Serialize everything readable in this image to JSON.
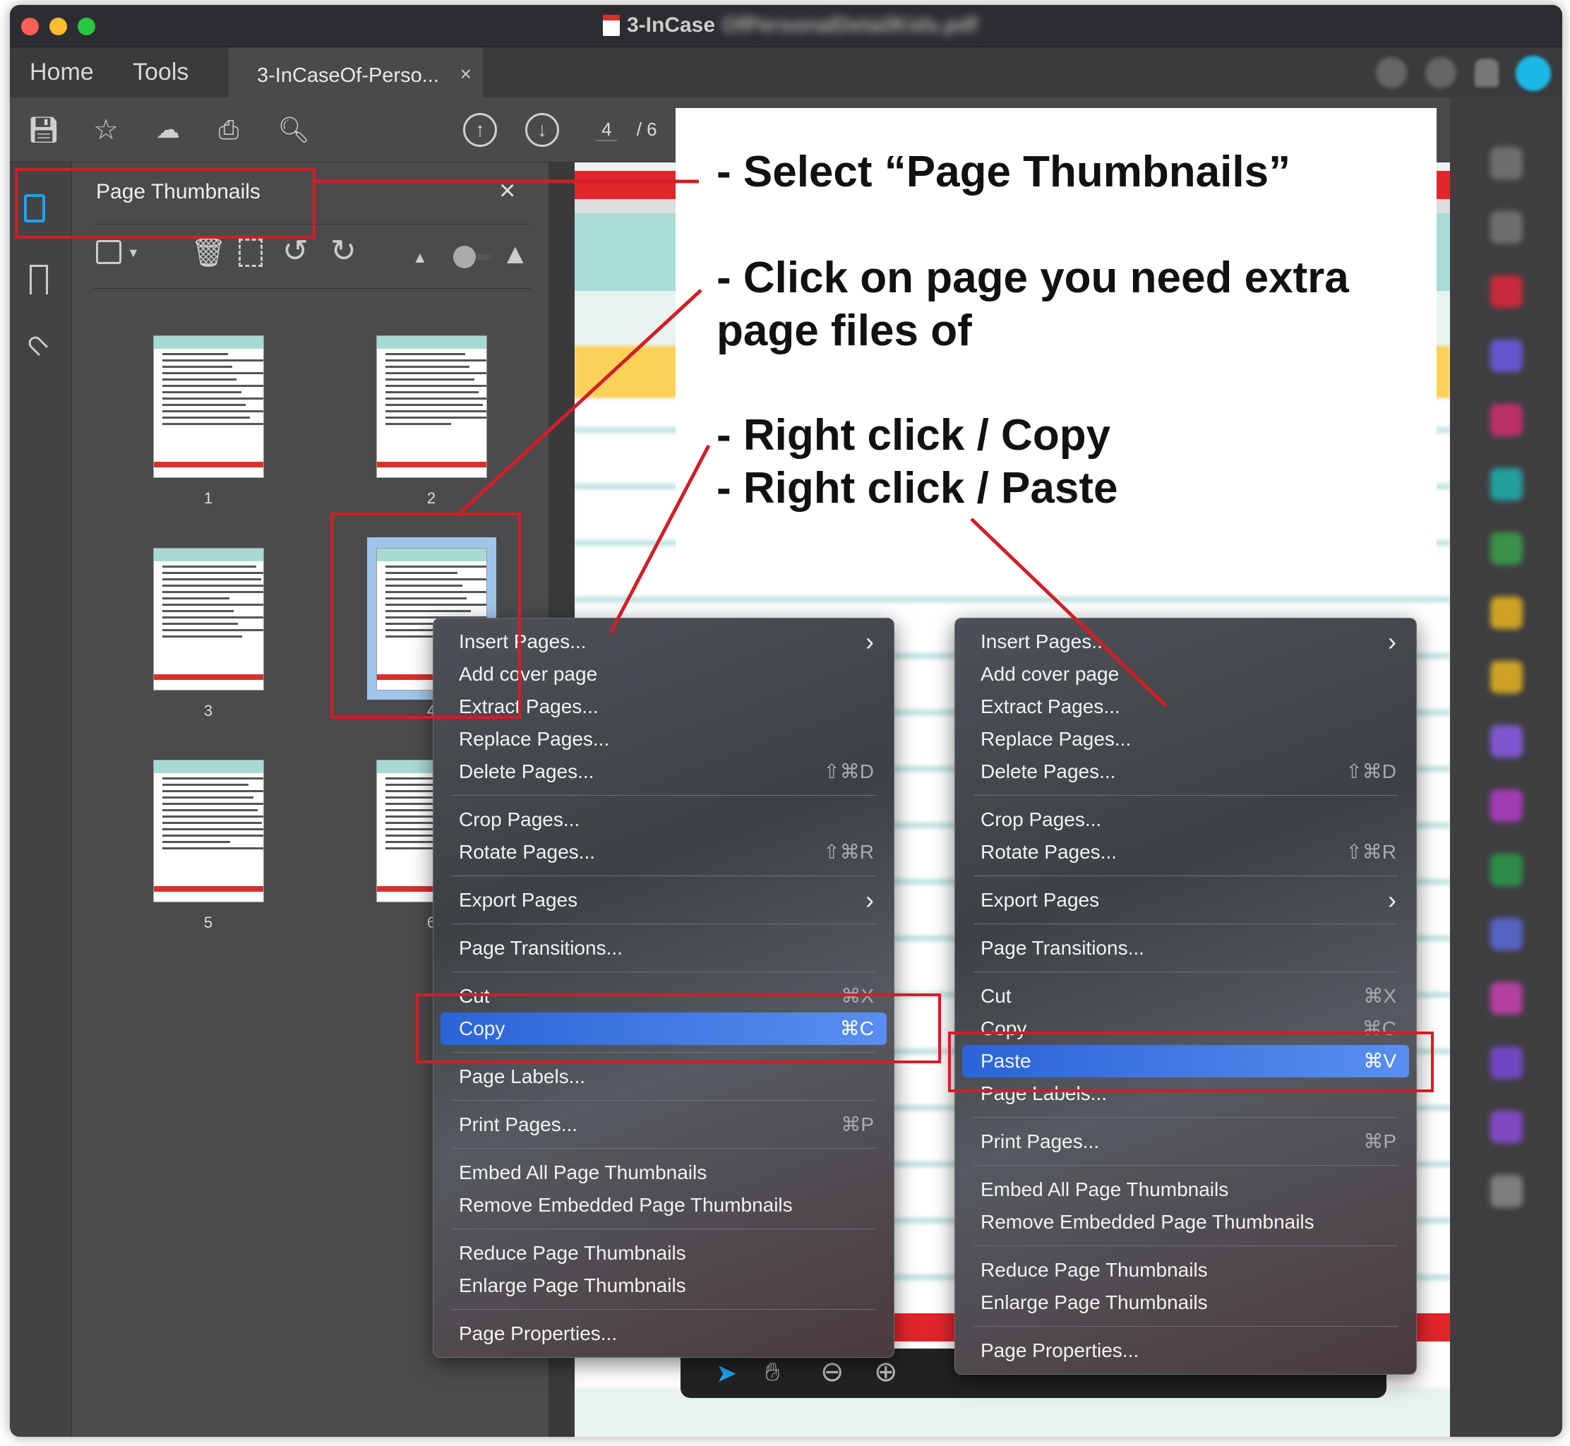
{
  "window": {
    "title": "3-InCaseOf-Personal-Detail-Kids.pdf",
    "title_visible": "3-InCase"
  },
  "tabs": {
    "home": "Home",
    "tools": "Tools",
    "document": "3-InCaseOf-Perso...",
    "close": "×"
  },
  "toolbar": {
    "current_page": "4",
    "total_pages": "/ 6"
  },
  "thumbnails_panel": {
    "title": "Page Thumbnails",
    "close": "×",
    "pages": [
      {
        "label": "1",
        "selected": false
      },
      {
        "label": "2",
        "selected": false
      },
      {
        "label": "3",
        "selected": false
      },
      {
        "label": "4",
        "selected": true
      },
      {
        "label": "5",
        "selected": false
      },
      {
        "label": "6",
        "selected": false
      }
    ]
  },
  "annotations": {
    "step1": "- Select “Page Thumbnails”",
    "step2_line1": "- Click on page you need extra",
    "step2_line2": "page files of",
    "step3": "- Right click / Copy",
    "step4": "- Right click / Paste"
  },
  "menu_copy": [
    {
      "label": "Insert Pages...",
      "submenu": true
    },
    {
      "label": "Add cover page"
    },
    {
      "label": "Extract Pages..."
    },
    {
      "label": "Replace Pages..."
    },
    {
      "label": "Delete Pages...",
      "shortcut": "⇧⌘D"
    },
    {
      "sep": true
    },
    {
      "label": "Crop Pages..."
    },
    {
      "label": "Rotate Pages...",
      "shortcut": "⇧⌘R"
    },
    {
      "sep": true
    },
    {
      "label": "Export Pages",
      "submenu": true
    },
    {
      "sep": true
    },
    {
      "label": "Page Transitions..."
    },
    {
      "sep": true
    },
    {
      "label": "Cut",
      "shortcut": "⌘X"
    },
    {
      "label": "Copy",
      "shortcut": "⌘C",
      "highlighted": true
    },
    {
      "sep": true
    },
    {
      "label": "Page Labels..."
    },
    {
      "sep": true
    },
    {
      "label": "Print Pages...",
      "shortcut": "⌘P"
    },
    {
      "sep": true
    },
    {
      "label": "Embed All Page Thumbnails"
    },
    {
      "label": "Remove Embedded Page Thumbnails"
    },
    {
      "sep": true
    },
    {
      "label": "Reduce Page Thumbnails"
    },
    {
      "label": "Enlarge Page Thumbnails"
    },
    {
      "sep": true
    },
    {
      "label": "Page Properties..."
    }
  ],
  "menu_paste": [
    {
      "label": "Insert Pages...",
      "submenu": true
    },
    {
      "label": "Add cover page"
    },
    {
      "label": "Extract Pages..."
    },
    {
      "label": "Replace Pages..."
    },
    {
      "label": "Delete Pages...",
      "shortcut": "⇧⌘D"
    },
    {
      "sep": true
    },
    {
      "label": "Crop Pages..."
    },
    {
      "label": "Rotate Pages...",
      "shortcut": "⇧⌘R"
    },
    {
      "sep": true
    },
    {
      "label": "Export Pages",
      "submenu": true
    },
    {
      "sep": true
    },
    {
      "label": "Page Transitions..."
    },
    {
      "sep": true
    },
    {
      "label": "Cut",
      "shortcut": "⌘X"
    },
    {
      "label": "Copy",
      "shortcut": "⌘C"
    },
    {
      "label": "Paste",
      "shortcut": "⌘V",
      "highlighted": true
    },
    {
      "label": "Page Labels..."
    },
    {
      "sep": true
    },
    {
      "label": "Print Pages...",
      "shortcut": "⌘P"
    },
    {
      "sep": true
    },
    {
      "label": "Embed All Page Thumbnails"
    },
    {
      "label": "Remove Embedded Page Thumbnails"
    },
    {
      "sep": true
    },
    {
      "label": "Reduce Page Thumbnails"
    },
    {
      "label": "Enlarge Page Thumbnails"
    },
    {
      "sep": true
    },
    {
      "label": "Page Properties..."
    }
  ],
  "colors": {
    "annotation_red": "#d21e25",
    "highlight_blue": "#3a78e8",
    "active_icon": "#1fa3f0"
  }
}
